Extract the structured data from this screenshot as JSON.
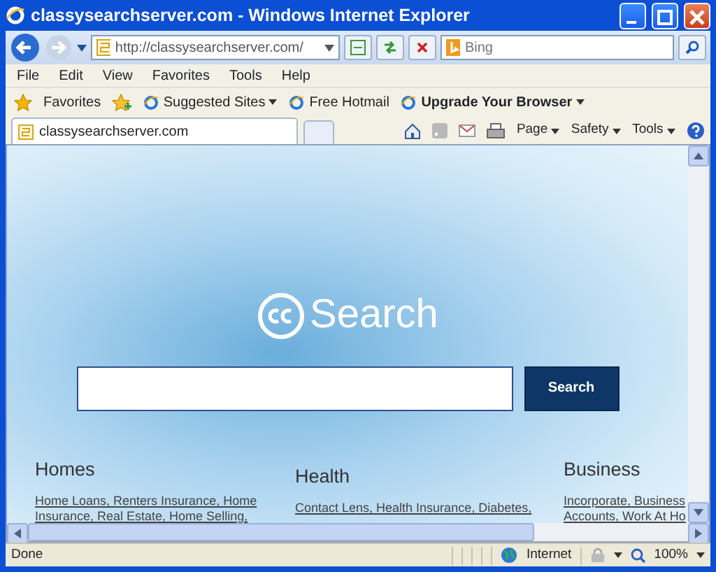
{
  "window": {
    "title": "classysearchserver.com - Windows Internet Explorer"
  },
  "address_bar": {
    "url": "http://classysearchserver.com/"
  },
  "search_box": {
    "placeholder": "Bing"
  },
  "menu": [
    "File",
    "Edit",
    "View",
    "Favorites",
    "Tools",
    "Help"
  ],
  "favorites_bar": {
    "label": "Favorites",
    "links": [
      {
        "label": "Suggested Sites",
        "dropdown": true,
        "emphasized": false
      },
      {
        "label": "Free Hotmail",
        "dropdown": false,
        "emphasized": false
      },
      {
        "label": "Upgrade Your Browser",
        "dropdown": true,
        "emphasized": true
      }
    ]
  },
  "tabs": [
    {
      "label": "classysearchserver.com",
      "selected": true
    }
  ],
  "command_bar": [
    "Page",
    "Safety",
    "Tools"
  ],
  "page": {
    "logo": "Search",
    "search_button": "Search",
    "categories": [
      {
        "title": "Homes",
        "lines": [
          "Home Loans, Renters Insurance, Home",
          "Insurance, Real Estate, Home Selling,"
        ]
      },
      {
        "title": "Health",
        "lines": [
          "Contact Lens, Health Insurance, Diabetes,"
        ]
      },
      {
        "title": "Business",
        "lines": [
          "Incorporate, Business",
          "Accounts, Work At Ho"
        ]
      }
    ]
  },
  "status_bar": {
    "status": "Done",
    "zone": "Internet",
    "zoom": "100%"
  }
}
